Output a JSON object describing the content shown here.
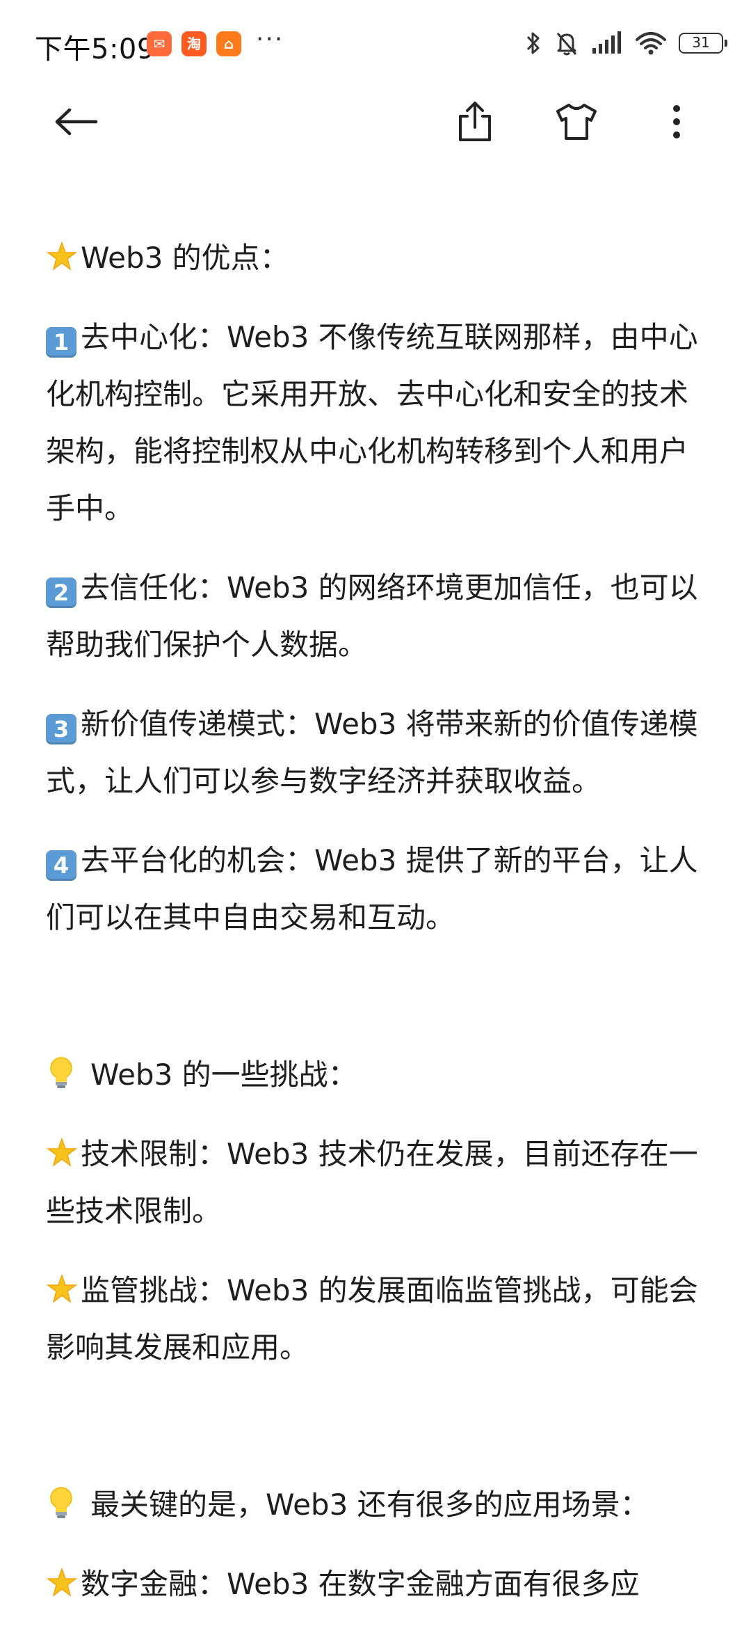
{
  "status_bar": {
    "time": "下午5:09",
    "app_icon_1": "✉",
    "app_icon_2": "淘",
    "app_icon_3": "⌂",
    "more_indicator": "···",
    "battery": "31",
    "icons": [
      "bluetooth-icon",
      "mute-icon",
      "signal-icon",
      "wifi-icon",
      "battery-icon"
    ]
  },
  "app_bar": {
    "icons": [
      "back-arrow-icon",
      "share-icon",
      "tshirt-icon",
      "more-vertical-icon"
    ]
  },
  "content": {
    "advantages_heading": "Web3 的优点：",
    "advantages": [
      {
        "num": "1",
        "text": "去中心化：Web3 不像传统互联网那样，由中心化机构控制。它采用开放、去中心化和安全的技术架构，能将控制权从中心化机构转移到个人和用户手中。"
      },
      {
        "num": "2",
        "text": "去信任化：Web3 的网络环境更加信任，也可以帮助我们保护个人数据。"
      },
      {
        "num": "3",
        "text": "新价值传递模式：Web3 将带来新的价值传递模式，让人们可以参与数字经济并获取收益。"
      },
      {
        "num": "4",
        "text": "去平台化的机会：Web3 提供了新的平台，让人们可以在其中自由交易和互动。"
      }
    ],
    "challenges_heading": "Web3 的一些挑战：",
    "challenges": [
      {
        "text": "技术限制：Web3 技术仍在发展，目前还存在一些技术限制。"
      },
      {
        "text": "监管挑战：Web3 的发展面临监管挑战，可能会影响其发展和应用。"
      }
    ],
    "key_heading": "最关键的是，Web3 还有很多的应用场景：",
    "applications": [
      {
        "text": "数字金融：Web3 在数字金融方面有很多应"
      }
    ]
  }
}
